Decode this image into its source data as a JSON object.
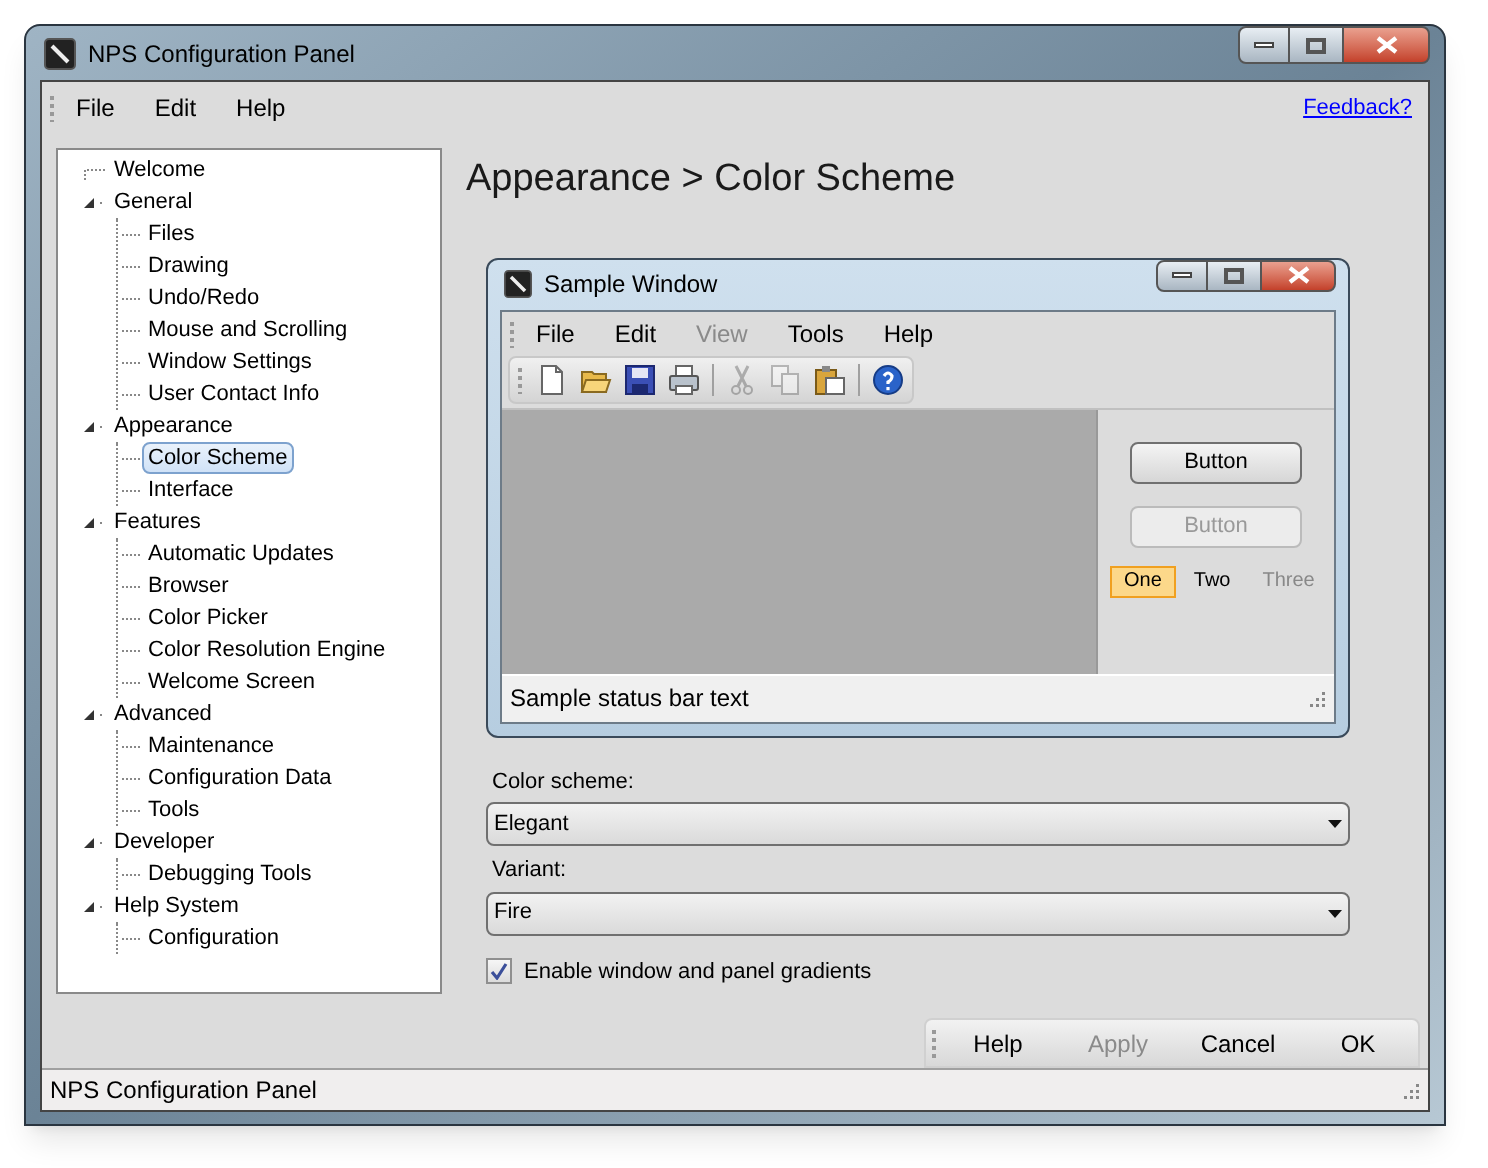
{
  "window": {
    "title": "NPS Configuration Panel"
  },
  "menu": [
    "File",
    "Edit",
    "Help"
  ],
  "feedback_link": "Feedback?",
  "tree": [
    {
      "label": "Welcome",
      "selected": false
    },
    {
      "label": "General",
      "selected": false,
      "expanded": true,
      "children": [
        {
          "label": "Files",
          "selected": false
        },
        {
          "label": "Drawing",
          "selected": false
        },
        {
          "label": "Undo/Redo",
          "selected": false
        },
        {
          "label": "Mouse and Scrolling",
          "selected": false
        },
        {
          "label": "Window Settings",
          "selected": false
        },
        {
          "label": "User Contact Info",
          "selected": false
        }
      ]
    },
    {
      "label": "Appearance",
      "selected": false,
      "expanded": true,
      "children": [
        {
          "label": "Color Scheme",
          "selected": true
        },
        {
          "label": "Interface",
          "selected": false
        }
      ]
    },
    {
      "label": "Features",
      "selected": false,
      "expanded": true,
      "children": [
        {
          "label": "Automatic Updates",
          "selected": false
        },
        {
          "label": "Browser",
          "selected": false
        },
        {
          "label": "Color Picker",
          "selected": false
        },
        {
          "label": "Color Resolution Engine",
          "selected": false
        },
        {
          "label": "Welcome Screen",
          "selected": false
        }
      ]
    },
    {
      "label": "Advanced",
      "selected": false,
      "expanded": true,
      "children": [
        {
          "label": "Maintenance",
          "selected": false
        },
        {
          "label": "Configuration Data",
          "selected": false
        },
        {
          "label": "Tools",
          "selected": false
        }
      ]
    },
    {
      "label": "Developer",
      "selected": false,
      "expanded": true,
      "children": [
        {
          "label": "Debugging Tools",
          "selected": false
        }
      ]
    },
    {
      "label": "Help System",
      "selected": false,
      "expanded": true,
      "children": [
        {
          "label": "Configuration",
          "selected": false
        }
      ]
    }
  ],
  "heading": "Appearance > Color Scheme",
  "sample_window": {
    "title": "Sample Window",
    "menu": [
      {
        "label": "File",
        "disabled": false
      },
      {
        "label": "Edit",
        "disabled": false
      },
      {
        "label": "View",
        "disabled": true
      },
      {
        "label": "Tools",
        "disabled": false
      },
      {
        "label": "Help",
        "disabled": false
      }
    ],
    "toolbar_groups": [
      {
        "items": [
          {
            "kind": "new",
            "disabled": false
          },
          {
            "kind": "open",
            "disabled": false
          },
          {
            "kind": "save",
            "disabled": false
          },
          {
            "kind": "print",
            "disabled": false
          }
        ]
      },
      {
        "items": [
          {
            "kind": "cut",
            "disabled": true
          },
          {
            "kind": "copy",
            "disabled": true
          },
          {
            "kind": "paste",
            "disabled": false
          }
        ]
      },
      {
        "items": [
          {
            "kind": "help",
            "disabled": false
          }
        ]
      }
    ],
    "buttons": [
      {
        "label": "Button",
        "disabled": false
      },
      {
        "label": "Button",
        "disabled": true
      }
    ],
    "tabs": [
      {
        "label": "One",
        "selected": true,
        "disabled": false
      },
      {
        "label": "Two",
        "selected": false,
        "disabled": false
      },
      {
        "label": "Three",
        "selected": false,
        "disabled": true
      }
    ],
    "status": "Sample status bar text"
  },
  "fields": [
    {
      "label": "Color scheme:",
      "value": "Elegant"
    },
    {
      "label": "Variant:",
      "value": "Fire"
    }
  ],
  "checkbox": {
    "label": "Enable window and panel gradients",
    "checked": true
  },
  "dialog_buttons": [
    {
      "label": "Help",
      "disabled": false
    },
    {
      "label": "Apply",
      "disabled": true
    },
    {
      "label": "Cancel",
      "disabled": false
    },
    {
      "label": "OK",
      "disabled": false
    }
  ],
  "status_bar": "NPS Configuration Panel"
}
